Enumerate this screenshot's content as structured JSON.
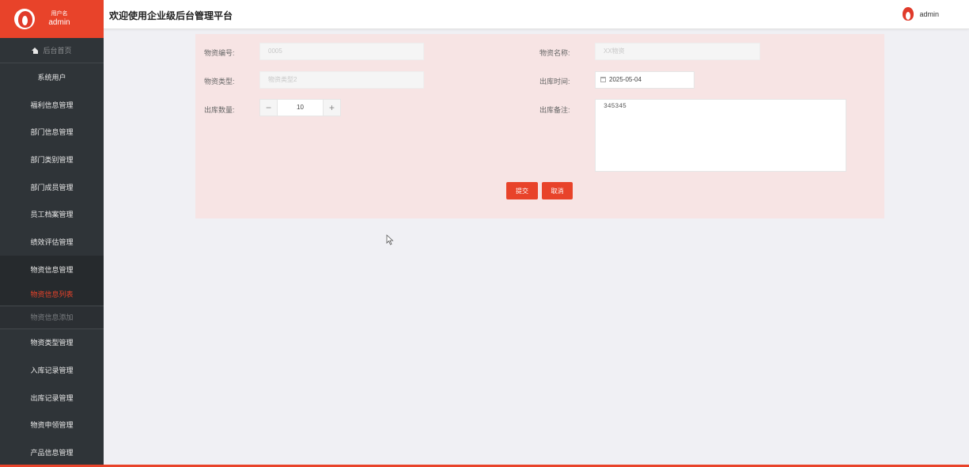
{
  "sidebar": {
    "user_label": "用户名",
    "user_name": "admin",
    "home": "后台首页",
    "items": [
      "系统用户",
      "福利信息管理",
      "部门信息管理",
      "部门类别管理",
      "部门成员管理",
      "员工档案管理",
      "绩效评估管理",
      "物资信息管理"
    ],
    "submenu": [
      "物资信息列表",
      "物资信息添加"
    ],
    "items_after": [
      "物资类型管理",
      "入库记录管理",
      "出库记录管理",
      "物资申领管理",
      "产品信息管理"
    ]
  },
  "header": {
    "title": "欢迎使用企业级后台管理平台",
    "username": "admin"
  },
  "form": {
    "code_label": "物资编号:",
    "code_value": "0005",
    "name_label": "物资名称:",
    "name_value": "XX物资",
    "type_label": "物资类型:",
    "type_value": "物资类型2",
    "time_label": "出库时间:",
    "time_value": "2025-05-04",
    "qty_label": "出库数量:",
    "qty_value": "10",
    "qty_minus": "−",
    "qty_plus": "+",
    "remark_label": "出库备注:",
    "remark_value": "345345",
    "submit": "提交",
    "cancel": "取消"
  },
  "colors": {
    "accent": "#e8432a",
    "sidebar_bg": "#2f3438",
    "panel_bg": "#f7e4e4"
  }
}
